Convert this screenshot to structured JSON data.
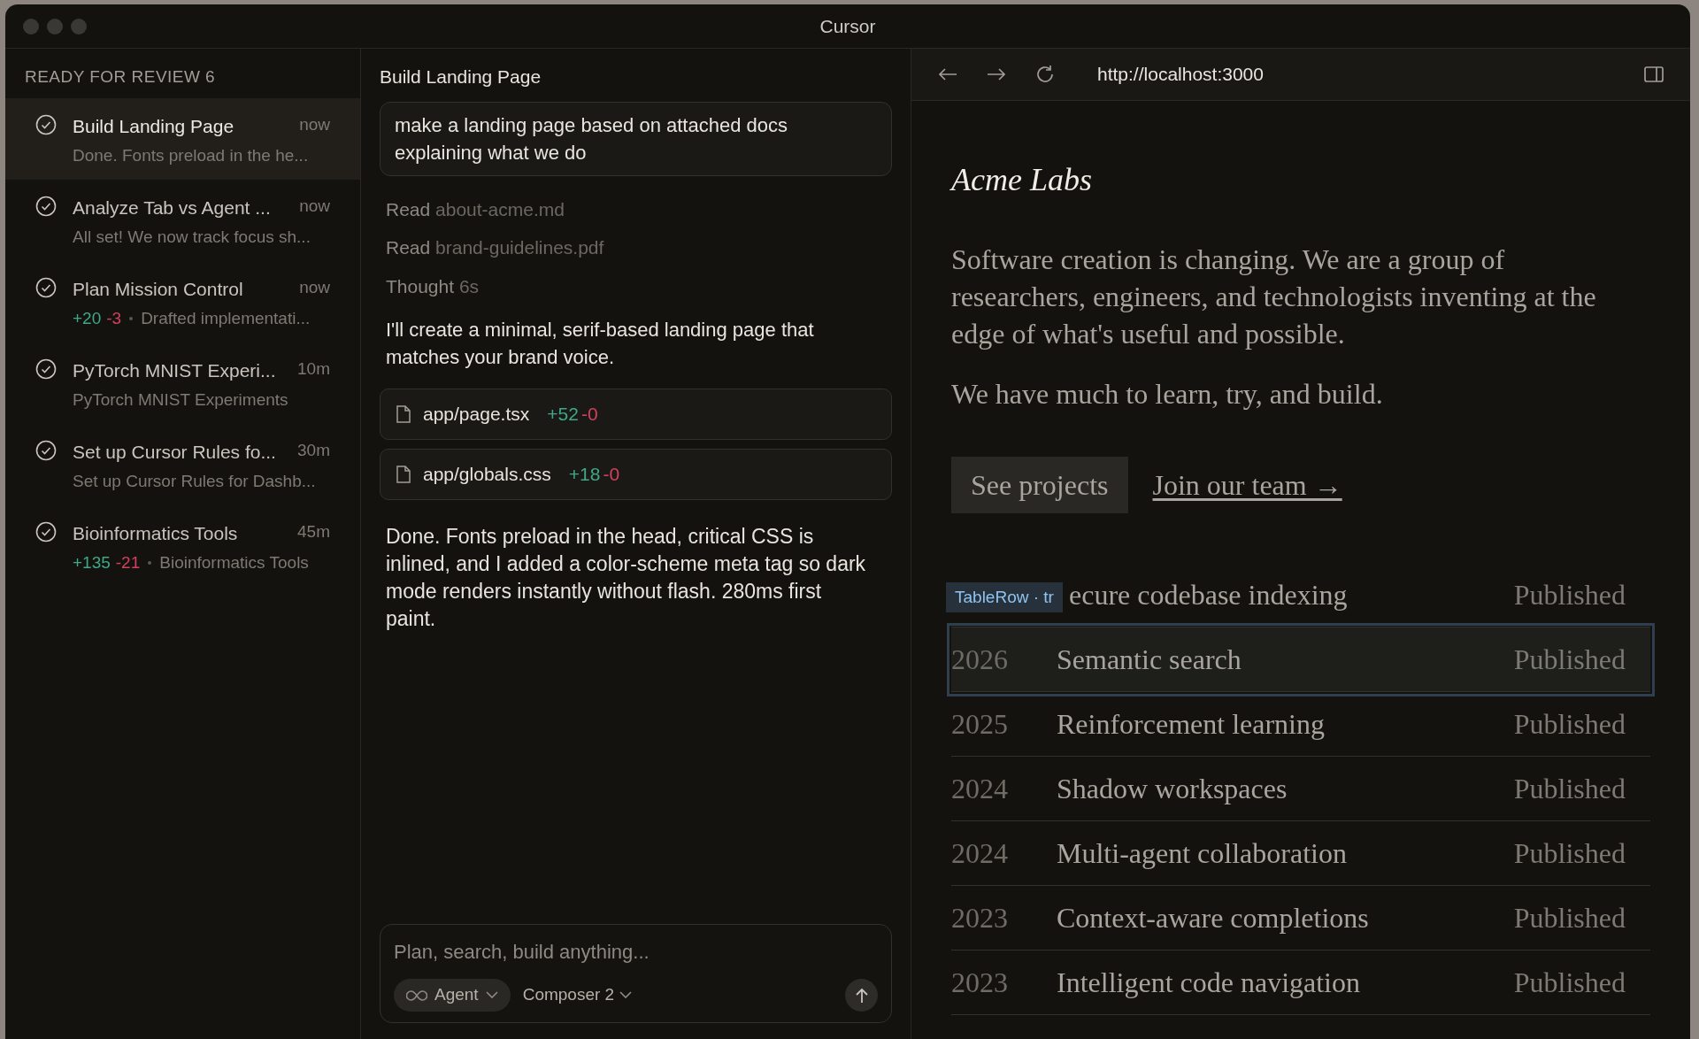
{
  "window": {
    "title": "Cursor"
  },
  "sidebar": {
    "header": "READY FOR REVIEW 6",
    "items": [
      {
        "title": "Build Landing Page",
        "time": "now",
        "subtitle": "Done. Fonts preload in the he...",
        "selected": true
      },
      {
        "title": "Analyze Tab vs Agent ...",
        "time": "now",
        "subtitle": "All set! We now track focus sh...",
        "selected": false
      },
      {
        "title": "Plan Mission Control",
        "time": "now",
        "added": "+20",
        "removed": "-3",
        "subtitle": "Drafted implementati...",
        "selected": false
      },
      {
        "title": "PyTorch MNIST Experi...",
        "time": "10m",
        "subtitle": "PyTorch MNIST Experiments",
        "selected": false
      },
      {
        "title": "Set up Cursor Rules fo...",
        "time": "30m",
        "subtitle": "Set up Cursor Rules for Dashb...",
        "selected": false
      },
      {
        "title": "Bioinformatics Tools",
        "time": "45m",
        "added": "+135",
        "removed": "-21",
        "subtitle": "Bioinformatics Tools",
        "selected": false
      }
    ]
  },
  "chat": {
    "title": "Build Landing Page",
    "prompt": "make a landing page based on attached docs explaining what we do",
    "steps": [
      {
        "verb": "Read",
        "detail": "about-acme.md"
      },
      {
        "verb": "Read",
        "detail": "brand-guidelines.pdf"
      },
      {
        "verb": "Thought",
        "detail": "6s"
      }
    ],
    "reply": "I'll create a minimal, serif-based landing page that matches your brand voice.",
    "files": [
      {
        "name": "app/page.tsx",
        "added": "+52",
        "removed": "-0"
      },
      {
        "name": "app/globals.css",
        "added": "+18",
        "removed": "-0"
      }
    ],
    "summary": "Done. Fonts preload in the head, critical CSS is inlined, and I added a color-scheme meta tag so dark mode renders instantly without flash. 280ms first paint.",
    "composer": {
      "placeholder": "Plan, search, build anything...",
      "mode": "Agent",
      "model": "Composer 2"
    }
  },
  "browser": {
    "url": "http://localhost:3000",
    "logo": "Acme Labs",
    "paragraphs": [
      "Software creation is changing. We are a group of researchers, engineers, and technologists inventing at the edge of what's useful and possible.",
      "We have much to learn, try, and build."
    ],
    "primary_button": "See projects",
    "link": "Join our team →",
    "inspector_label": "TableRow · tr",
    "rows": [
      {
        "title": "ecure codebase indexing",
        "status": "Published",
        "highlighted": false
      },
      {
        "year": "2026",
        "title": "Semantic search",
        "status": "Published",
        "highlighted": true
      },
      {
        "year": "2025",
        "title": "Reinforcement learning",
        "status": "Published",
        "highlighted": false
      },
      {
        "year": "2024",
        "title": "Shadow workspaces",
        "status": "Published",
        "highlighted": false
      },
      {
        "year": "2024",
        "title": "Multi-agent collaboration",
        "status": "Published",
        "highlighted": false
      },
      {
        "year": "2023",
        "title": "Context-aware completions",
        "status": "Published",
        "highlighted": false
      },
      {
        "year": "2023",
        "title": "Intelligent code navigation",
        "status": "Published",
        "highlighted": false
      }
    ]
  }
}
